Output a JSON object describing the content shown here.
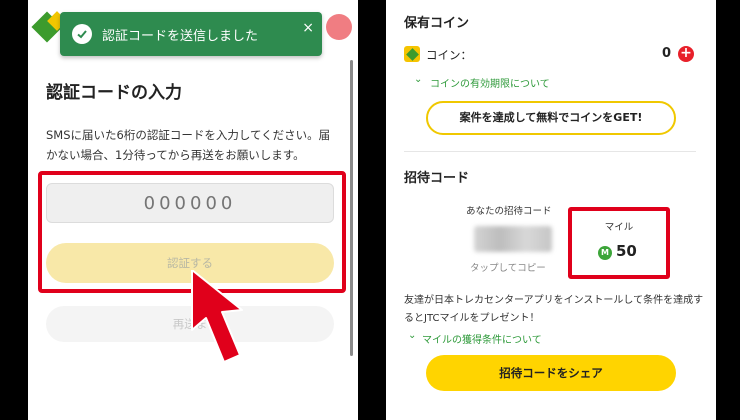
{
  "left": {
    "toast": {
      "message": "認証コードを送信しました",
      "close": "×"
    },
    "title": "認証コードの入力",
    "description": "SMSに届いた6桁の認証コードを入力してください。届かない場合、1分待ってから再送をお願いします。",
    "code_input": {
      "placeholder": "000000",
      "value": ""
    },
    "verify_label": "認証する",
    "resend_label": "再送ま"
  },
  "right": {
    "owned_coins": {
      "heading": "保有コイン",
      "coin_label": "コイン：",
      "coin_value": "0",
      "expiry_link": "コインの有効期限について",
      "earn_button": "案件を達成して無料でコインをGET!"
    },
    "invite": {
      "heading": "招待コード",
      "your_code_label": "あなたの招待コード",
      "tap_to_copy": "タップしてコピー",
      "mile_title": "マイル",
      "mile_icon_letter": "M",
      "mile_value": "50",
      "description": "友達が日本トレカセンターアプリをインストールして条件を達成するとJTCマイルをプレゼント！",
      "mile_link": "マイルの獲得条件について",
      "share_button": "招待コードをシェア"
    }
  },
  "colors": {
    "accent_yellow": "#ffd400",
    "link_green": "#2e9a3a",
    "toast_green": "#2e8b4f",
    "highlight_red": "#e0001b"
  }
}
